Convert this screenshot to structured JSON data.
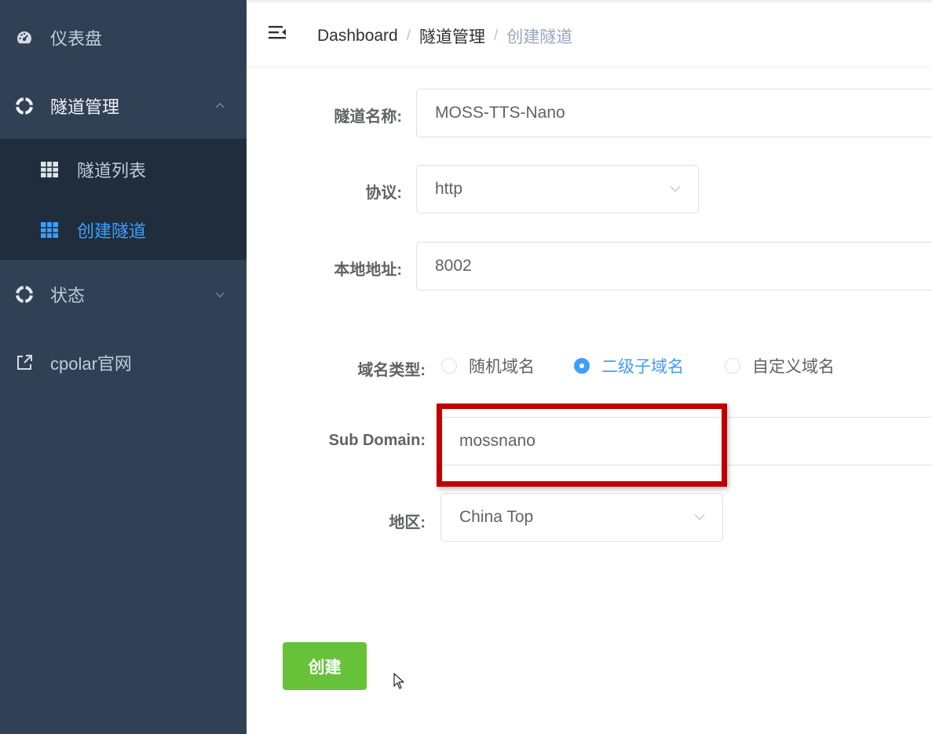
{
  "sidebar": {
    "items": [
      {
        "label": "仪表盘",
        "icon": "dashboard-gauge-icon"
      },
      {
        "label": "隧道管理",
        "icon": "lifebuoy-icon",
        "expanded": true
      },
      {
        "label": "状态",
        "icon": "lifebuoy-icon",
        "expanded": false
      },
      {
        "label": "cpolar官网",
        "icon": "external-link-icon"
      }
    ],
    "submenu": [
      {
        "label": "隧道列表",
        "icon": "grid-table-icon"
      },
      {
        "label": "创建隧道",
        "icon": "grid-table-icon",
        "active": true
      }
    ]
  },
  "header": {
    "breadcrumb": [
      "Dashboard",
      "隧道管理",
      "创建隧道"
    ],
    "separator": "/"
  },
  "form": {
    "name_label": "隧道名称:",
    "name_value": "MOSS-TTS-Nano",
    "protocol_label": "协议:",
    "protocol_value": "http",
    "local_label": "本地地址:",
    "local_value": "8002",
    "domain_type_label": "域名类型:",
    "domain_type_options": [
      "随机域名",
      "二级子域名",
      "自定义域名"
    ],
    "domain_type_selected": "二级子域名",
    "subdomain_label": "Sub Domain:",
    "subdomain_value": "mossnano",
    "region_label": "地区:",
    "region_value": "China Top",
    "submit_label": "创建"
  },
  "colors": {
    "sidebar_bg": "#304156",
    "submenu_bg": "#1f2d3d",
    "active_text": "#409eff",
    "button_green": "#67c23a",
    "highlight_red": "#c00000"
  }
}
